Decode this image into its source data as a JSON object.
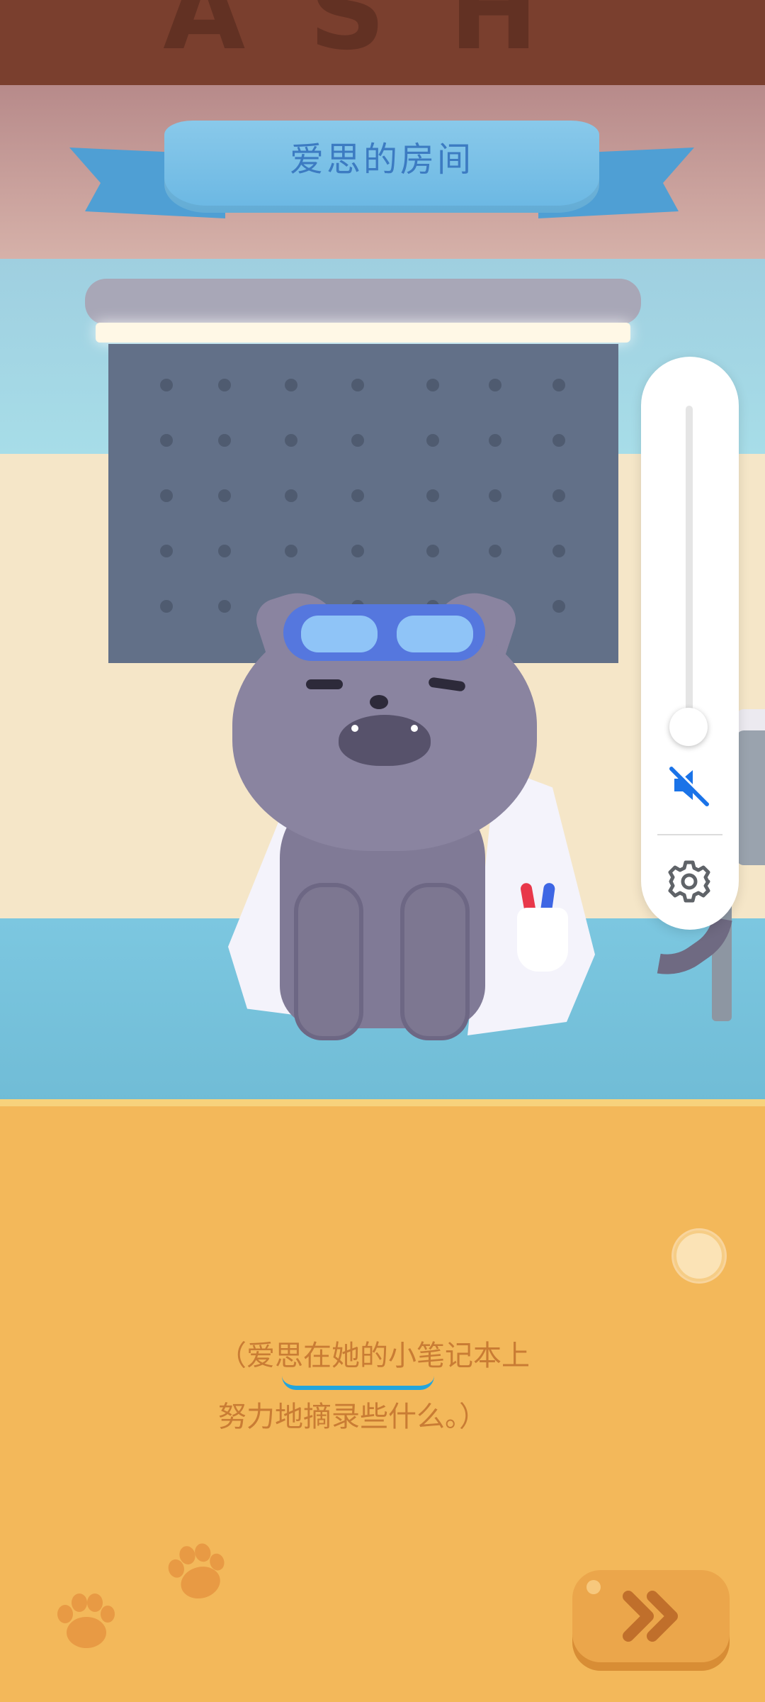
{
  "scene": {
    "sign_letters": "ASH",
    "banner_title": "爱思的房间"
  },
  "dialog": {
    "line1": "（爱思在她的小笔记本上",
    "line2": "努力地摘录些什么。）"
  },
  "volume_panel": {
    "level_fraction": 0.0,
    "muted": true
  },
  "icons": {
    "mute": "speaker-muted-icon",
    "settings": "gear-icon",
    "next": "double-chevron-right-icon",
    "paw": "paw-print-icon"
  },
  "colors": {
    "accent_blue": "#1a73e8",
    "dialog_text": "#c97c34",
    "next_button": "#eba64b",
    "underline": "#23a5dd"
  }
}
